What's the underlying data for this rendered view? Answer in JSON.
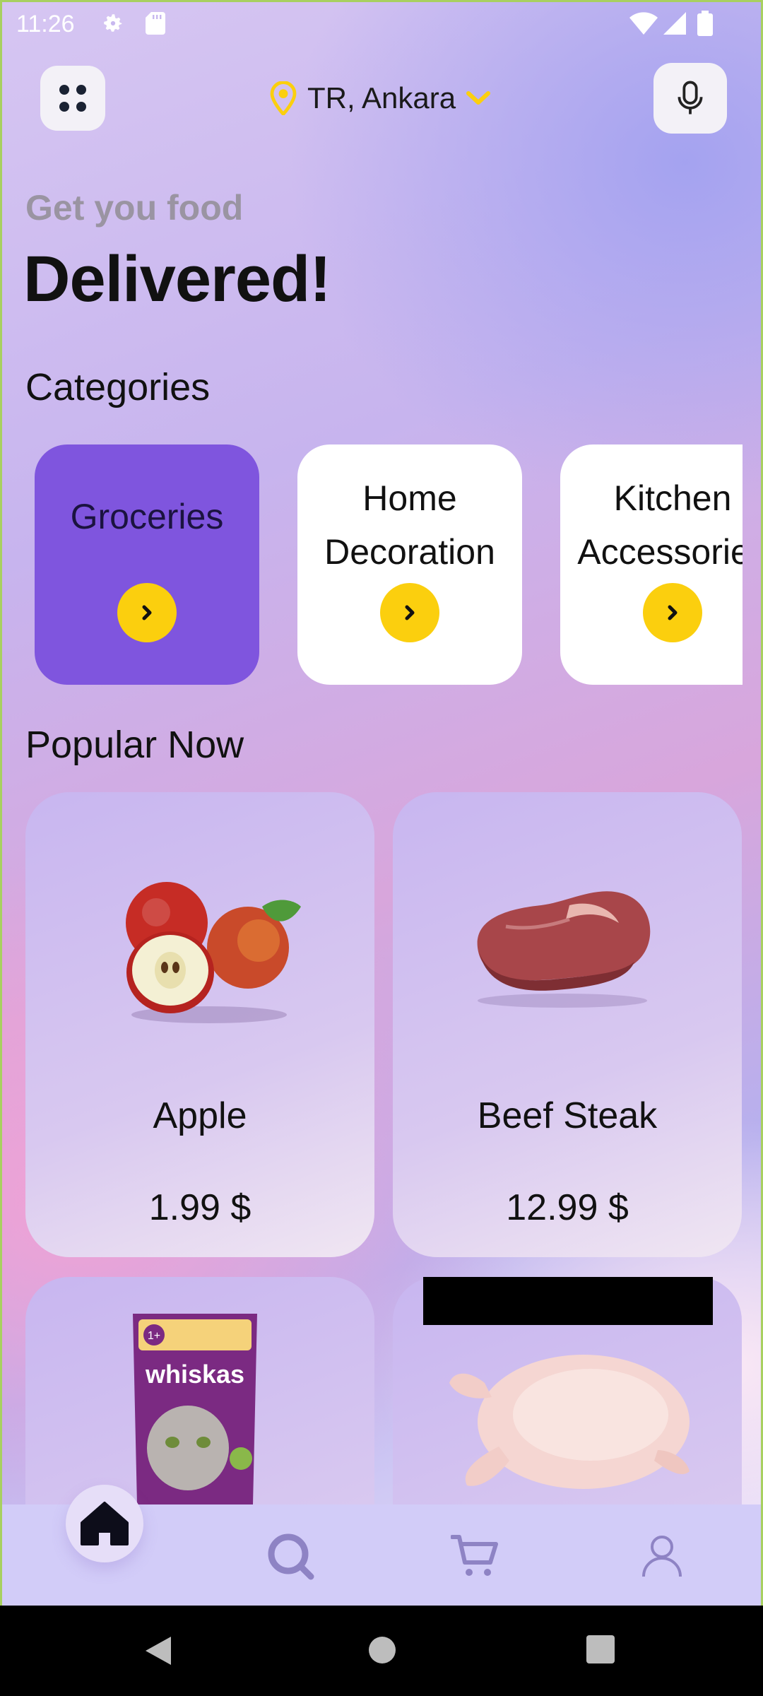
{
  "status_bar": {
    "time": "11:26"
  },
  "header": {
    "location": "TR, Ankara",
    "menu_icon": "grid-dots-icon",
    "mic_icon": "microphone-icon",
    "location_icon": "map-pin-icon",
    "dropdown_icon": "chevron-down-icon"
  },
  "hero": {
    "subtitle": "Get you food",
    "title": "Delivered!"
  },
  "categories": {
    "title": "Categories",
    "items": [
      {
        "label": "Groceries",
        "active": true
      },
      {
        "label": "Home\nDecoration",
        "active": false
      },
      {
        "label": "Kitchen\nAccessories",
        "active": false
      }
    ]
  },
  "popular": {
    "title": "Popular Now",
    "items": [
      {
        "name": "Apple",
        "price": "1.99 $"
      },
      {
        "name": "Beef Steak",
        "price": "12.99 $"
      },
      {
        "name": "",
        "price": ""
      },
      {
        "name": "",
        "price": ""
      }
    ]
  },
  "bottom_nav": {
    "items": [
      "home-icon",
      "search-icon",
      "cart-icon",
      "profile-icon"
    ],
    "active": "home-icon"
  },
  "colors": {
    "accent_purple": "#7f55de",
    "accent_yellow": "#fbcf0e",
    "nav_bg": "#d2ccf8"
  }
}
